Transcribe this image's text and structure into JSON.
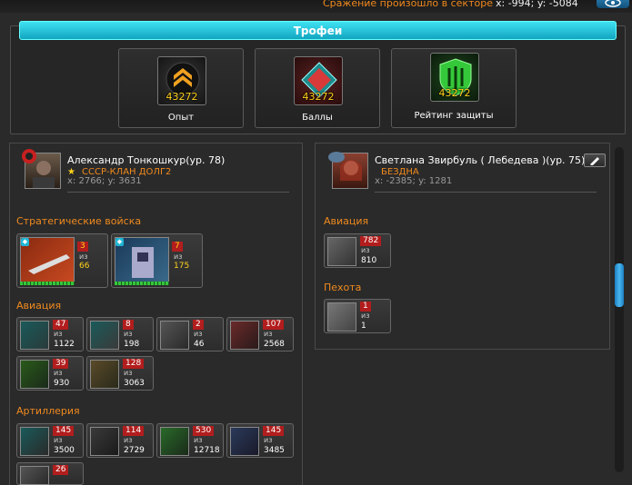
{
  "top": {
    "sector_message": "Сражение произошло в секторе",
    "sector_coords": "x: -994; y: -5084",
    "eye_icon": "eye-icon"
  },
  "trophies": {
    "title": "Трофеи",
    "items": [
      {
        "label": "Опыт",
        "value": "43272",
        "icon": "rank-chevron-icon",
        "color": "#f0a020"
      },
      {
        "label": "Баллы",
        "value": "43272",
        "icon": "diamond-points-icon",
        "color": "#d83a3a"
      },
      {
        "label": "Рейтинг защиты",
        "value": "43272",
        "icon": "shield-rating-icon",
        "color": "#35c83a"
      }
    ]
  },
  "players": {
    "left": {
      "name": "Александр Тонкошкур(ур. 78)",
      "clan": "СССР-КЛАН ДОЛГ2",
      "coords": "x: 2766; y: 3631",
      "sections": [
        {
          "title": "Стратегические войска",
          "units": [
            {
              "count": "3",
              "iz": "из",
              "total": "66"
            },
            {
              "count": "7",
              "iz": "из",
              "total": "175"
            }
          ]
        },
        {
          "title": "Авиация",
          "units": [
            {
              "count": "47",
              "iz": "из",
              "total": "1122"
            },
            {
              "count": "8",
              "iz": "из",
              "total": "198"
            },
            {
              "count": "2",
              "iz": "из",
              "total": "46"
            },
            {
              "count": "107",
              "iz": "из",
              "total": "2568"
            },
            {
              "count": "39",
              "iz": "из",
              "total": "930"
            },
            {
              "count": "128",
              "iz": "из",
              "total": "3063"
            }
          ]
        },
        {
          "title": "Артиллерия",
          "units": [
            {
              "count": "145",
              "iz": "из",
              "total": "3500"
            },
            {
              "count": "114",
              "iz": "из",
              "total": "2729"
            },
            {
              "count": "530",
              "iz": "из",
              "total": "12718"
            },
            {
              "count": "145",
              "iz": "из",
              "total": "3485"
            },
            {
              "count": "26",
              "iz": "",
              "total": ""
            }
          ]
        }
      ]
    },
    "right": {
      "name": "Светлана Звирбуль ( Лебедева )(ур. 75)",
      "clan": "БЕЗДНА",
      "coords": "x: -2385; y: 1281",
      "sections": [
        {
          "title": "Авиация",
          "units": [
            {
              "count": "782",
              "iz": "из",
              "total": "810"
            }
          ]
        },
        {
          "title": "Пехота",
          "units": [
            {
              "count": "1",
              "iz": "из",
              "total": "1"
            }
          ]
        }
      ]
    }
  }
}
